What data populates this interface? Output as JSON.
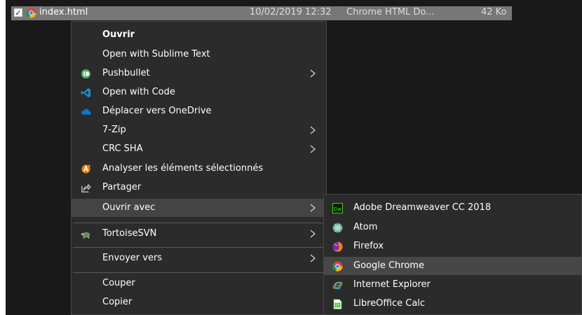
{
  "file_row": {
    "name": "index.html",
    "date": "10/02/2019 12:32",
    "type": "Chrome HTML Do...",
    "size": "42 Ko"
  },
  "context_menu": {
    "items": [
      {
        "label": "Ouvrir",
        "bold": true
      },
      {
        "label": "Open with Sublime Text"
      },
      {
        "label": "Pushbullet",
        "icon": "pushbullet-icon",
        "submenu": true
      },
      {
        "label": "Open with Code",
        "icon": "vscode-icon"
      },
      {
        "label": "Déplacer vers OneDrive",
        "icon": "onedrive-icon"
      },
      {
        "label": "7-Zip",
        "submenu": true
      },
      {
        "label": "CRC SHA",
        "submenu": true
      },
      {
        "label": "Analyser les éléments sélectionnés",
        "icon": "avast-icon"
      },
      {
        "label": "Partager",
        "icon": "share-icon"
      },
      {
        "label": "Ouvrir avec",
        "submenu": true,
        "highlighted": true
      },
      {
        "label": "TortoiseSVN",
        "icon": "tortoisesvn-icon",
        "submenu": true
      },
      {
        "label": "Envoyer vers",
        "submenu": true
      },
      {
        "label": "Couper"
      },
      {
        "label": "Copier"
      }
    ]
  },
  "submenu": {
    "items": [
      {
        "label": "Adobe Dreamweaver CC 2018",
        "icon": "dreamweaver-icon"
      },
      {
        "label": "Atom",
        "icon": "atom-icon"
      },
      {
        "label": "Firefox",
        "icon": "firefox-icon"
      },
      {
        "label": "Google Chrome",
        "icon": "chrome-icon",
        "highlighted": true
      },
      {
        "label": "Internet Explorer",
        "icon": "internet-explorer-icon"
      },
      {
        "label": "LibreOffice Calc",
        "icon": "libreoffice-calc-icon"
      }
    ]
  },
  "colors": {
    "background": "#191919",
    "menu_bg": "#2b2b2b",
    "highlight": "#444444",
    "file_row_bg": "#777777"
  }
}
